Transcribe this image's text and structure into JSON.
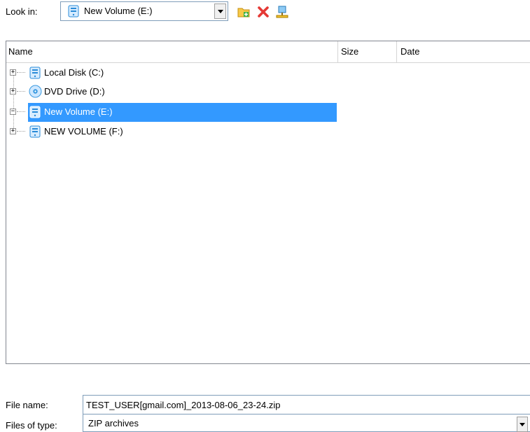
{
  "look_in": {
    "label": "Look in:",
    "value": "New Volume (E:)",
    "icon": "drive-icon"
  },
  "toolbar": {
    "buttons": [
      {
        "name": "new-folder-icon"
      },
      {
        "name": "delete-icon"
      },
      {
        "name": "network-drive-icon"
      }
    ]
  },
  "columns": {
    "name": "Name",
    "size": "Size",
    "date": "Date"
  },
  "tree": {
    "items": [
      {
        "label": "Local Disk (C:)",
        "icon": "drive-icon",
        "expander": "+",
        "selected": false
      },
      {
        "label": "DVD Drive (D:)",
        "icon": "dvd-icon",
        "expander": "+",
        "selected": false
      },
      {
        "label": "New Volume (E:)",
        "icon": "drive-icon",
        "expander": "−",
        "selected": true
      },
      {
        "label": "NEW VOLUME (F:)",
        "icon": "drive-icon",
        "expander": "+",
        "selected": false
      }
    ]
  },
  "file_name": {
    "label": "File name:",
    "value": "TEST_USER[gmail.com]_2013-08-06_23-24.zip"
  },
  "file_type": {
    "label": "Files of type:",
    "value": "ZIP archives"
  },
  "colors": {
    "selection": "#3399ff",
    "border": "#7f9db9"
  }
}
